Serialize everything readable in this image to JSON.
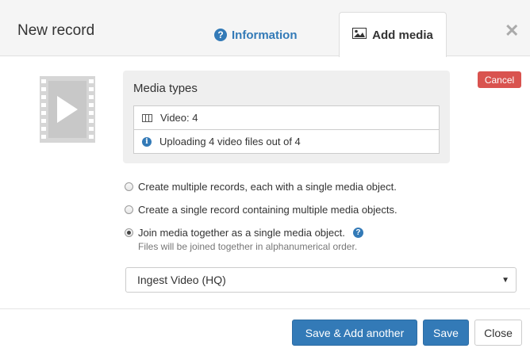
{
  "dialog": {
    "title": "New record",
    "close_icon": "close-icon"
  },
  "tabs": [
    {
      "label": "Information",
      "icon": "question-circle-icon",
      "active": false
    },
    {
      "label": "Add media",
      "icon": "image-icon",
      "active": true
    }
  ],
  "media": {
    "thumbnail_icon": "video-file-icon",
    "types_title": "Media types",
    "rows": [
      {
        "icon": "film-icon",
        "text": "Video: 4"
      },
      {
        "icon": "info-circle-icon",
        "text": "Uploading 4 video files out of 4"
      }
    ],
    "cancel_label": "Cancel"
  },
  "options": {
    "radio1": "Create multiple records, each with a single media object.",
    "radio2": "Create a single record containing multiple media objects.",
    "radio3": "Join media together as a single media object.",
    "selected": "radio3",
    "hint": "Files will be joined together in alphanumerical order."
  },
  "profile_select": {
    "value": "Ingest Video (HQ)"
  },
  "footer": {
    "save_add_label": "Save & Add another",
    "save_label": "Save",
    "close_label": "Close"
  },
  "colors": {
    "primary": "#337ab7",
    "danger": "#d9534f",
    "header_bg": "#f5f5f5"
  }
}
